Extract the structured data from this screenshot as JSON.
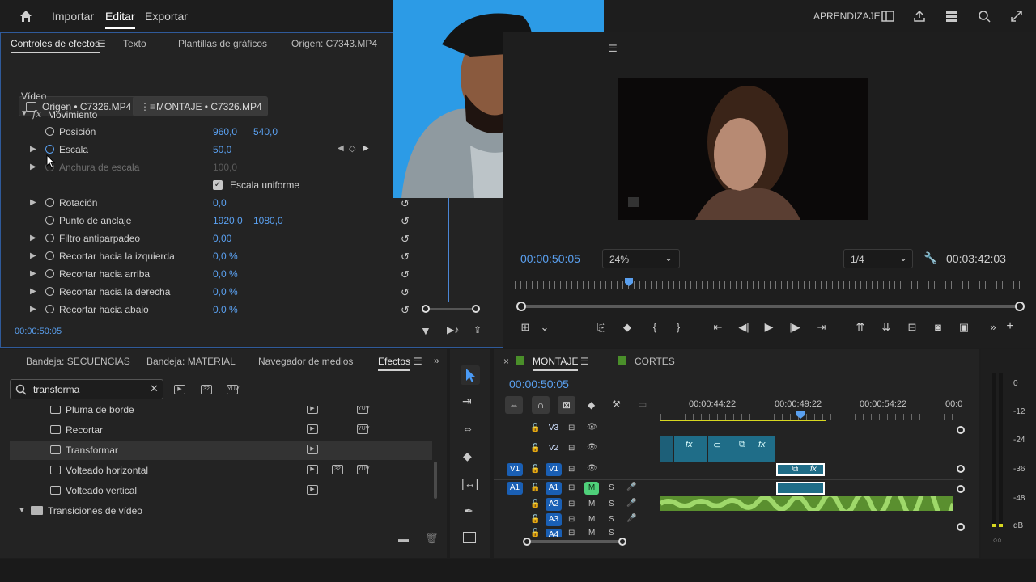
{
  "header": {
    "home_icon": "home-icon",
    "nav": [
      "Importar",
      "Editar",
      "Exportar"
    ],
    "active_nav": "Editar",
    "learning_label": "APRENDIZAJE"
  },
  "effect_controls": {
    "tabs": [
      "Controles de efectos",
      "Texto",
      "Plantillas de gráficos",
      "Origen: C7343.MP4"
    ],
    "source_chip": "Origen • C7326.MP4",
    "sequence_chip": "MONTAJE • C7326.MP4",
    "section_video": "Vídeo",
    "group_motion": "Movimiento",
    "rows": [
      {
        "label": "Posición",
        "v1": "960,0",
        "v2": "540,0"
      },
      {
        "label": "Escala",
        "v1": "50,0",
        "v2": ""
      },
      {
        "label": "Anchura de escala",
        "v1": "100,0",
        "v2": ""
      },
      {
        "label": "Escala uniforme",
        "v1": "",
        "v2": ""
      },
      {
        "label": "Rotación",
        "v1": "0,0",
        "v2": ""
      },
      {
        "label": "Punto de anclaje",
        "v1": "1920,0",
        "v2": "1080,0"
      },
      {
        "label": "Filtro antiparpadeo",
        "v1": "0,00",
        "v2": ""
      },
      {
        "label": "Recortar hacia la izquierda",
        "v1": "0,0 %",
        "v2": ""
      },
      {
        "label": "Recortar hacia arriba",
        "v1": "0,0 %",
        "v2": ""
      },
      {
        "label": "Recortar hacia la derecha",
        "v1": "0,0 %",
        "v2": ""
      },
      {
        "label": "Recortar hacia abajo",
        "v1": "0,0 %",
        "v2": ""
      }
    ],
    "timecode": "00:00:50:05"
  },
  "program_monitor": {
    "timecode": "00:00:50:05",
    "zoom": "24%",
    "resolution": "1/4",
    "duration": "00:03:42:03"
  },
  "project": {
    "tabs": [
      "Bandeja: SECUENCIAS",
      "Bandeja: MATERIAL",
      "Navegador de medios",
      "Efectos"
    ],
    "active_tab": "Efectos",
    "search_value": "transforma",
    "items": [
      "Pluma de borde",
      "Recortar",
      "Transformar",
      "Volteado horizontal",
      "Volteado vertical"
    ],
    "folder": "Transiciones de vídeo"
  },
  "timeline": {
    "tab_active": "MONTAJE",
    "tab_other": "CORTES",
    "timecode": "00:00:50:05",
    "ruler": [
      "00:00:44:22",
      "00:00:49:22",
      "00:00:54:22",
      "00:0"
    ],
    "tracks_video": [
      "V3",
      "V2",
      "V1"
    ],
    "tracks_audio": [
      "A1",
      "A2",
      "A3",
      "A4"
    ],
    "src_v": "V1",
    "src_a": "A1",
    "m_label": "M",
    "s_label": "S"
  },
  "meters": {
    "scale": [
      "0",
      "-12",
      "-24",
      "-36",
      "-48",
      "dB"
    ]
  }
}
